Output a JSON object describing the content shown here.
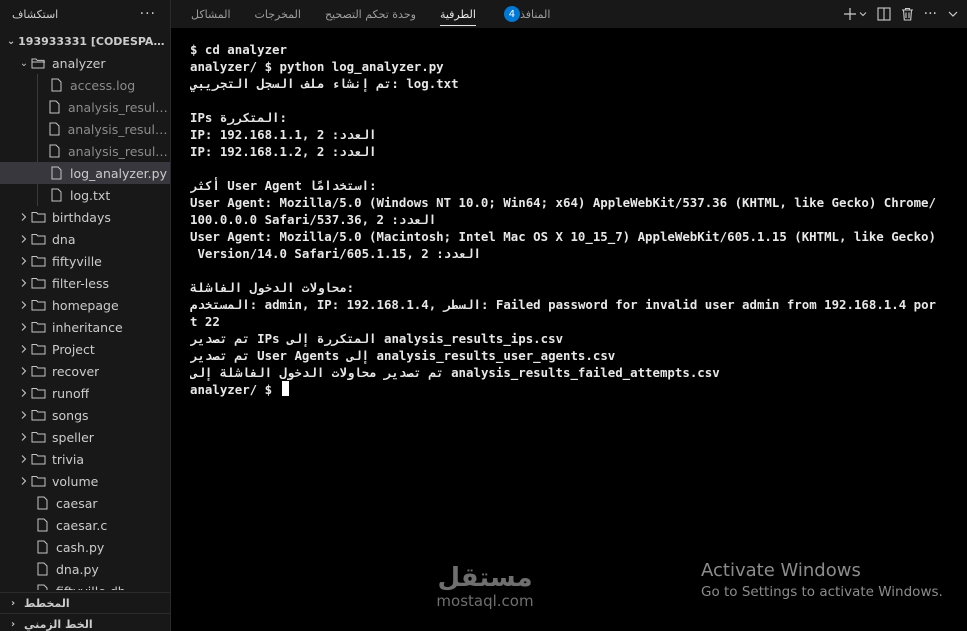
{
  "sidebar": {
    "title": "استكشاف",
    "more_icon": "ellipsis-icon",
    "root_label": "193933331 [CODESPACES: ...",
    "analyzer_folder": "analyzer",
    "analyzer_files": [
      {
        "name": "access.log",
        "dim": true
      },
      {
        "name": "analysis_results_...",
        "dim": true
      },
      {
        "name": "analysis_results_i...",
        "dim": true
      },
      {
        "name": "analysis_results_...",
        "dim": true
      },
      {
        "name": "log_analyzer.py",
        "dim": false,
        "selected": true
      },
      {
        "name": "log.txt",
        "dim": false
      }
    ],
    "folders": [
      "birthdays",
      "dna",
      "fiftyville",
      "filter-less",
      "homepage",
      "inheritance",
      "Project",
      "recover",
      "runoff",
      "songs",
      "speller",
      "trivia",
      "volume"
    ],
    "files": [
      "caesar",
      "caesar.c",
      "cash.py",
      "dna.py",
      "fiftyville.db"
    ],
    "outline_label": "المخطط",
    "timeline_label": "الخط الزمني"
  },
  "panel": {
    "tabs": [
      {
        "label": "المشاكل",
        "active": false
      },
      {
        "label": "المخرجات",
        "active": false
      },
      {
        "label": "وحدة تحكم التصحيح",
        "active": false
      },
      {
        "label": "الطرفية",
        "active": true
      },
      {
        "label": "المنافذ",
        "active": false,
        "badge": "4"
      }
    ],
    "actions": [
      "plus-icon",
      "chevron-down-icon",
      "split-icon",
      "trash-icon",
      "ellipsis-icon",
      "chevron-down-icon"
    ]
  },
  "terminal": {
    "lines": [
      "$ cd analyzer",
      "analyzer/ $ python log_analyzer.py",
      "تم إنشاء ملف السجل التجريبي: log.txt",
      "",
      "IPs المتكررة:",
      "IP: 192.168.1.1, العدد: 2",
      "IP: 192.168.1.2, العدد: 2",
      "",
      "أكثر User Agent استخدامًا:",
      "User Agent: Mozilla/5.0 (Windows NT 10.0; Win64; x64) AppleWebKit/537.36 (KHTML, like Gecko) Chrome/",
      "100.0.0.0 Safari/537.36, العدد: 2",
      "User Agent: Mozilla/5.0 (Macintosh; Intel Mac OS X 10_15_7) AppleWebKit/605.1.15 (KHTML, like Gecko)",
      " Version/14.0 Safari/605.1.15, العدد: 2",
      "",
      "محاولات الدخول الفاشلة:",
      "المستخدم: admin, IP: 192.168.1.4, السطر: Failed password for invalid user admin from 192.168.1.4 por",
      "t 22",
      "تم تصدير IPs المتكررة إلى analysis_results_ips.csv",
      "تم تصدير User Agents إلى analysis_results_user_agents.csv",
      "تم تصدير محاولات الدخول الفاشلة إلى analysis_results_failed_attempts.csv",
      "analyzer/ $ "
    ]
  },
  "watermark": {
    "arabic": "مستقل",
    "latin": "mostaql.com"
  },
  "activation": {
    "title": "Activate Windows",
    "subtitle": "Go to Settings to activate Windows."
  }
}
